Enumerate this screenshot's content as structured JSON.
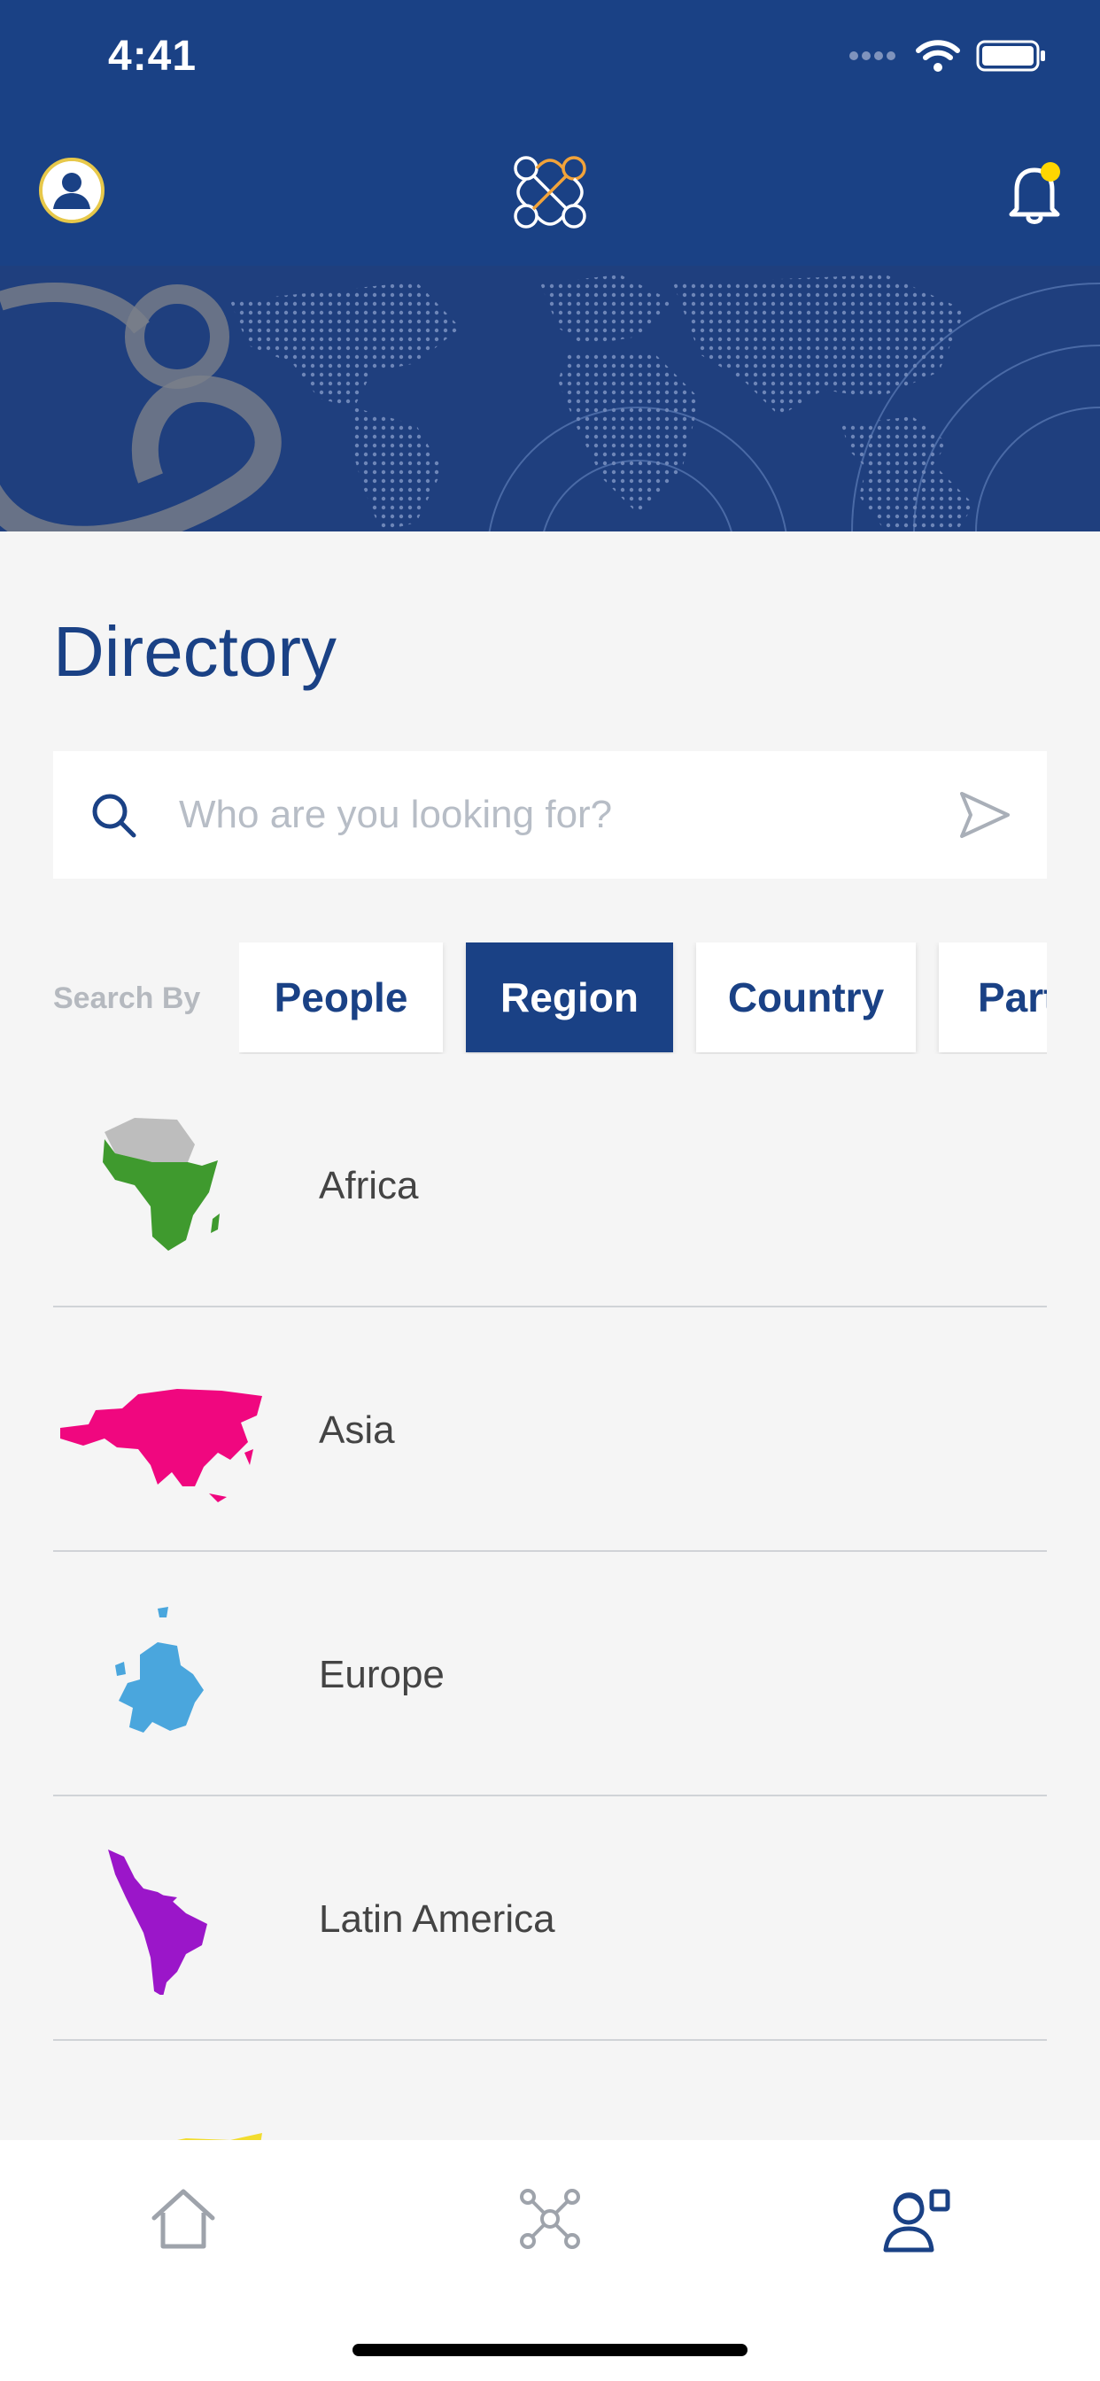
{
  "status_bar": {
    "time": "4:41"
  },
  "header": {
    "profile_icon": "person-icon",
    "logo_icon": "network-loops-logo",
    "notification_icon": "bell-icon",
    "notification_dot_color": "#ffd600"
  },
  "page": {
    "title": "Directory"
  },
  "search": {
    "placeholder": "Who are you looking for?",
    "value": ""
  },
  "filter": {
    "label": "Search By",
    "options": [
      "People",
      "Region",
      "Country",
      "Partner"
    ],
    "selected": "Region"
  },
  "regions": [
    {
      "name": "Africa",
      "color": "#3f9a2e"
    },
    {
      "name": "Asia",
      "color": "#f0077f"
    },
    {
      "name": "Europe",
      "color": "#4aa6dd"
    },
    {
      "name": "Latin America",
      "color": "#9b16c9"
    },
    {
      "name": "",
      "color": "#f2dc2e"
    }
  ],
  "tab_bar": {
    "tabs": [
      "home-icon",
      "network-icon",
      "directory-person-icon"
    ],
    "active": "directory-person-icon"
  },
  "colors": {
    "primary": "#1a4185",
    "background": "#f5f5f5",
    "accent": "#f2a33a"
  }
}
